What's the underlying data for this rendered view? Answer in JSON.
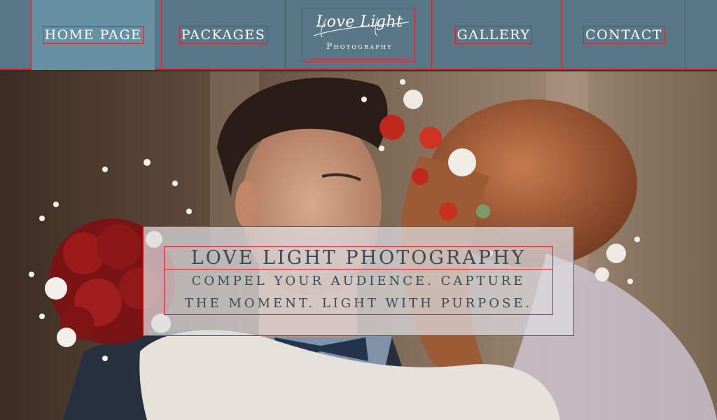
{
  "nav": {
    "items": [
      {
        "label": "HOME PAGE",
        "active": true
      },
      {
        "label": "PACKAGES",
        "active": false
      },
      {
        "label": "GALLERY",
        "active": false
      },
      {
        "label": "CONTACT",
        "active": false
      }
    ],
    "logo": {
      "script": "Love Light",
      "sub": "Photography"
    }
  },
  "hero": {
    "title": "LOVE LIGHT PHOTOGRAPHY",
    "subtitle_line1": "COMPEL YOUR AUDIENCE. CAPTURE",
    "subtitle_line2": "THE MOMENT. LIGHT WITH PURPOSE."
  },
  "colors": {
    "nav_bg": "#587887",
    "nav_active": "#6790a3",
    "outline": "#d6202a",
    "tagline_text": "#394a55"
  }
}
